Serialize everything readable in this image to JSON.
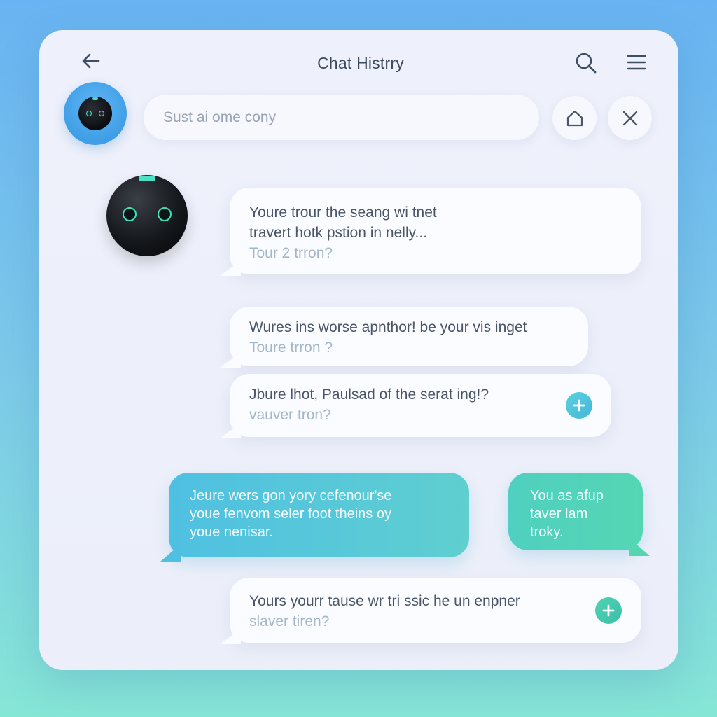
{
  "header": {
    "title": "Chat Histrry",
    "back_icon": "arrow-left-icon",
    "search_icon": "search-icon",
    "menu_icon": "hamburger-menu-icon"
  },
  "search": {
    "placeholder": "Sust ai ome cony",
    "home_icon": "home-icon",
    "close_icon": "close-icon"
  },
  "messages": [
    {
      "direction": "incoming",
      "lines": [
        "Youre trour the seang wi tnet",
        "travert hotk pstion in nelly..."
      ],
      "sub": "Tour 2 trron?"
    },
    {
      "direction": "incoming",
      "lines": [
        "Wures ins worse apnthor! be your vis inget"
      ],
      "sub": "Toure trron ?"
    },
    {
      "direction": "incoming",
      "lines": [
        "Jbure lhot, Paulsad of the serat ing!?"
      ],
      "sub": "vauver tron?",
      "action_icon": "plus-icon"
    },
    {
      "direction": "outgoing",
      "lines": [
        "Jeure wers gon yory cefenour'se",
        "youe fenvom seler foot theins oy",
        "youe nenisar."
      ]
    },
    {
      "direction": "outgoing",
      "lines": [
        "You as afup",
        "taver lam",
        "troky."
      ]
    },
    {
      "direction": "incoming",
      "lines": [
        "Yours yourr tause wr tri ssic he un enpner"
      ],
      "sub": "slaver tiren?",
      "action_icon": "plus-icon"
    }
  ],
  "colors": {
    "background_top": "#69b3f2",
    "background_bottom": "#86e6d6",
    "accent_blue": "#4fc0e2",
    "accent_green": "#55d6b3",
    "text_primary": "#4a5568",
    "text_faint": "#a2b7c9"
  }
}
